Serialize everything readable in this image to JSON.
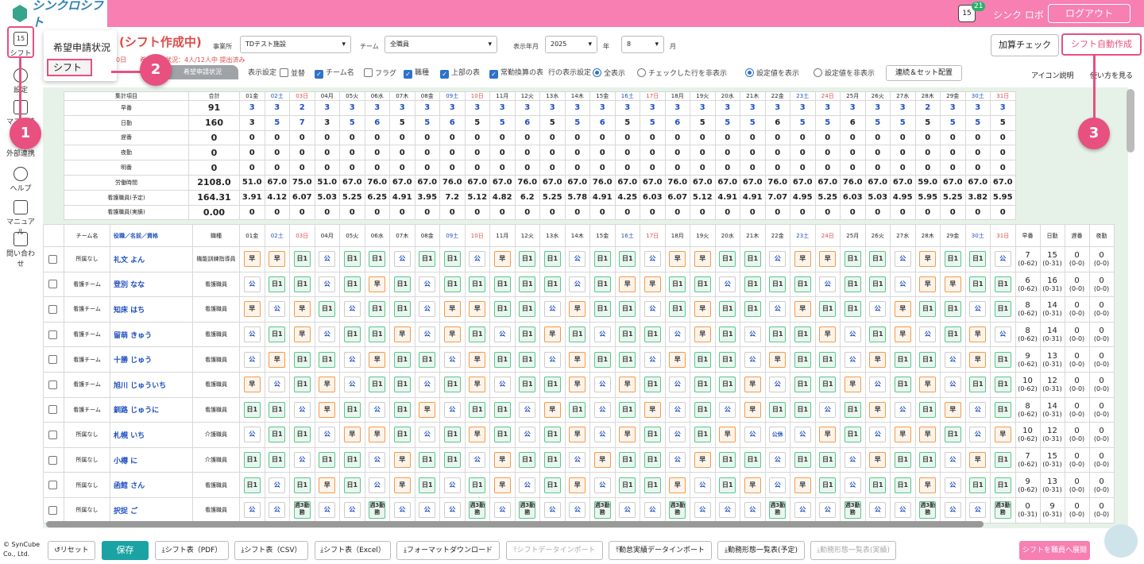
{
  "app": {
    "name": "シンクロシフト",
    "notifications": "21",
    "user": "シンク ロボ",
    "logout": "ログアウト",
    "cal_day": "15"
  },
  "sidebar": [
    {
      "label": "シフト",
      "icon": "calendar-icon"
    },
    {
      "label": "設定",
      "icon": "gear-icon"
    },
    {
      "label": "マスタ管理",
      "icon": "database-icon"
    },
    {
      "label": "外部連携",
      "icon": "link-icon"
    },
    {
      "label": "ヘルプ",
      "icon": "help-icon"
    },
    {
      "label": "マニュアル",
      "icon": "edit-icon"
    },
    {
      "label": "問い合わせ",
      "icon": "mail-icon"
    }
  ],
  "menu": {
    "item1": "希望申請状況",
    "item2": "シフト"
  },
  "annotations": {
    "a1": "1",
    "a2": "2",
    "a3": "3"
  },
  "header": {
    "title": "(シフト作成中)",
    "note1": "0日",
    "note2": "希望申請状況：4人/12人中 提出済み",
    "sub_tab": "希望申請状況",
    "office_label": "事業所",
    "office": "TDテスト施設",
    "team_label": "チーム",
    "team": "全職員",
    "ym_label": "表示年月",
    "year": "2025",
    "year_unit": "年",
    "month": "8",
    "month_unit": "月",
    "calc_check": "加算チェック",
    "auto_create": "シフト自動作成"
  },
  "options": {
    "display_label": "表示設定",
    "sort": "並替",
    "team_name": "チーム名",
    "flag": "フラグ",
    "job": "職種",
    "top_table": "上部の表",
    "fulltime": "常勤換算の表",
    "row_label": "行の表示設定",
    "show_all": "全表示",
    "hide_checked": "チェックした行を非表示",
    "show_settings": "設定値を表示",
    "hide_settings": "設定値を非表示",
    "link_btn": "連続＆セット配置",
    "icon_help": "アイコン説明",
    "howto": "使い方を見る"
  },
  "summary": {
    "header_item": "集計項目",
    "header_total": "合計",
    "days": [
      "01金",
      "02土",
      "03日",
      "04月",
      "05火",
      "06水",
      "07木",
      "08金",
      "09土",
      "10日",
      "11月",
      "12火",
      "13水",
      "14木",
      "15金",
      "16土",
      "17日",
      "18月",
      "19火",
      "20水",
      "21木",
      "22金",
      "23土",
      "24日",
      "25月",
      "26火",
      "27水",
      "28木",
      "29金",
      "30土",
      "31日"
    ],
    "rows": [
      {
        "label": "早番",
        "total": "91",
        "vals": [
          "3",
          "3",
          "2",
          "3",
          "3",
          "3",
          "3",
          "3",
          "3",
          "3",
          "3",
          "3",
          "3",
          "3",
          "3",
          "3",
          "3",
          "3",
          "3",
          "3",
          "3",
          "3",
          "3",
          "3",
          "3",
          "3",
          "3",
          "2",
          "3",
          "3",
          "3"
        ]
      },
      {
        "label": "日勤",
        "total": "160",
        "vals": [
          "3",
          "5",
          "7",
          "3",
          "5",
          "6",
          "5",
          "5",
          "6",
          "5",
          "5",
          "6",
          "5",
          "5",
          "6",
          "5",
          "5",
          "6",
          "5",
          "5",
          "5",
          "6",
          "5",
          "5",
          "6",
          "5",
          "5",
          "5",
          "5",
          "5",
          "5"
        ]
      },
      {
        "label": "遅番",
        "total": "0",
        "vals": [
          "0",
          "0",
          "0",
          "0",
          "0",
          "0",
          "0",
          "0",
          "0",
          "0",
          "0",
          "0",
          "0",
          "0",
          "0",
          "0",
          "0",
          "0",
          "0",
          "0",
          "0",
          "0",
          "0",
          "0",
          "0",
          "0",
          "0",
          "0",
          "0",
          "0",
          "0"
        ]
      },
      {
        "label": "夜勤",
        "total": "0",
        "vals": [
          "0",
          "0",
          "0",
          "0",
          "0",
          "0",
          "0",
          "0",
          "0",
          "0",
          "0",
          "0",
          "0",
          "0",
          "0",
          "0",
          "0",
          "0",
          "0",
          "0",
          "0",
          "0",
          "0",
          "0",
          "0",
          "0",
          "0",
          "0",
          "0",
          "0",
          "0"
        ]
      },
      {
        "label": "明番",
        "total": "0",
        "vals": [
          "0",
          "0",
          "0",
          "0",
          "0",
          "0",
          "0",
          "0",
          "0",
          "0",
          "0",
          "0",
          "0",
          "0",
          "0",
          "0",
          "0",
          "0",
          "0",
          "0",
          "0",
          "0",
          "0",
          "0",
          "0",
          "0",
          "0",
          "0",
          "0",
          "0",
          "0"
        ]
      },
      {
        "label": "労働時間",
        "total": "2108.0",
        "vals": [
          "51.0",
          "67.0",
          "75.0",
          "51.0",
          "67.0",
          "76.0",
          "67.0",
          "67.0",
          "76.0",
          "67.0",
          "67.0",
          "76.0",
          "67.0",
          "67.0",
          "76.0",
          "67.0",
          "67.0",
          "76.0",
          "67.0",
          "67.0",
          "67.0",
          "76.0",
          "67.0",
          "67.0",
          "76.0",
          "67.0",
          "67.0",
          "59.0",
          "67.0",
          "67.0",
          "67.0"
        ]
      },
      {
        "label": "看護職員(予定)",
        "total": "164.31",
        "vals": [
          "3.91",
          "4.12",
          "6.07",
          "5.03",
          "5.25",
          "6.25",
          "4.91",
          "3.95",
          "7.2",
          "5.12",
          "4.82",
          "6.2",
          "5.25",
          "5.78",
          "4.91",
          "4.25",
          "6.03",
          "6.07",
          "5.12",
          "4.91",
          "4.91",
          "7.07",
          "4.95",
          "5.25",
          "6.03",
          "5.03",
          "4.95",
          "5.95",
          "5.25",
          "3.82",
          "5.95"
        ]
      },
      {
        "label": "看護職員(実績)",
        "total": "0.00",
        "vals": [
          "0",
          "0",
          "0",
          "0",
          "0",
          "0",
          "0",
          "0",
          "0",
          "0",
          "0",
          "0",
          "0",
          "0",
          "0",
          "0",
          "0",
          "0",
          "0",
          "0",
          "0",
          "0",
          "0",
          "0",
          "0",
          "0",
          "0",
          "0",
          "0",
          "0",
          "0"
        ]
      }
    ]
  },
  "staff_table": {
    "col_team": "チーム名",
    "col_name": "役職／名前／資格",
    "col_job": "職種",
    "col_haya": "早番",
    "col_nichi": "日勤",
    "col_oso": "遅番",
    "col_yakin": "夜勤",
    "rows": [
      {
        "team": "所属なし",
        "name": "礼文 よん",
        "job": "機能訓練指導員",
        "shifts": [
          "早",
          "早",
          "日1",
          "公",
          "日1",
          "日1",
          "公",
          "日1",
          "日1",
          "公",
          "早",
          "日1",
          "日1",
          "公",
          "日1",
          "日1",
          "公",
          "早",
          "早",
          "日1",
          "日1",
          "公",
          "早",
          "早",
          "日1",
          "日1",
          "公",
          "早",
          "日1",
          "日1",
          "公"
        ],
        "st": [
          "7",
          "15",
          "0",
          "0"
        ],
        "rng": [
          "(0-62)",
          "(0-31)",
          "(0-0)",
          "(0-0)"
        ]
      },
      {
        "team": "看護チーム",
        "name": "登別 なな",
        "job": "看護職員",
        "shifts": [
          "公",
          "日1",
          "日1",
          "公",
          "日1",
          "早",
          "日1",
          "公",
          "日1",
          "日1",
          "日1",
          "日1",
          "日1",
          "公",
          "日1",
          "早",
          "早",
          "日1",
          "日1",
          "公",
          "日1",
          "日1",
          "日1",
          "公",
          "日1",
          "日1",
          "公",
          "早",
          "早",
          "日1",
          "日1"
        ],
        "st": [
          "6",
          "16",
          "0",
          "0"
        ],
        "rng": [
          "(0-62)",
          "(0-31)",
          "(0-0)",
          "(0-0)"
        ]
      },
      {
        "team": "看護チーム",
        "name": "知床 はち",
        "job": "看護職員",
        "shifts": [
          "早",
          "公",
          "早",
          "日1",
          "公",
          "日1",
          "日1",
          "公",
          "早",
          "早",
          "日1",
          "日1",
          "公",
          "早",
          "日1",
          "日1",
          "公",
          "日1",
          "早",
          "日1",
          "日1",
          "公",
          "早",
          "日1",
          "日1",
          "公",
          "早",
          "日1",
          "日1",
          "公",
          "日1"
        ],
        "st": [
          "8",
          "14",
          "0",
          "0"
        ],
        "rng": [
          "(0-62)",
          "(0-31)",
          "(0-0)",
          "(0-0)"
        ]
      },
      {
        "team": "看護チーム",
        "name": "留萌 きゅう",
        "job": "看護職員",
        "shifts": [
          "公",
          "日1",
          "早",
          "公",
          "日1",
          "日1",
          "早",
          "公",
          "早",
          "日1",
          "公",
          "日1",
          "早",
          "日1",
          "公",
          "日1",
          "日1",
          "公",
          "早",
          "日1",
          "公",
          "日1",
          "日1",
          "早",
          "公",
          "日1",
          "早",
          "公",
          "日1",
          "早",
          "公"
        ],
        "st": [
          "8",
          "14",
          "0",
          "0"
        ],
        "rng": [
          "(0-62)",
          "(0-31)",
          "(0-0)",
          "(0-0)"
        ]
      },
      {
        "team": "看護チーム",
        "name": "十勝 じゅう",
        "job": "看護職員",
        "shifts": [
          "公",
          "早",
          "日1",
          "日1",
          "公",
          "早",
          "日1",
          "日1",
          "公",
          "早",
          "日1",
          "日1",
          "公",
          "早",
          "日1",
          "日1",
          "公",
          "早",
          "日1",
          "日1",
          "公",
          "早",
          "日1",
          "日1",
          "公",
          "早",
          "日1",
          "日1",
          "公",
          "早",
          "日1"
        ],
        "st": [
          "9",
          "13",
          "0",
          "0"
        ],
        "rng": [
          "(0-62)",
          "(0-31)",
          "(0-0)",
          "(0-0)"
        ]
      },
      {
        "team": "看護チーム",
        "name": "旭川 じゅういち",
        "job": "看護職員",
        "shifts": [
          "早",
          "公",
          "日1",
          "早",
          "公",
          "日1",
          "日1",
          "公",
          "日1",
          "早",
          "公",
          "日1",
          "日1",
          "早",
          "公",
          "早",
          "日1",
          "公",
          "日1",
          "日1",
          "早",
          "公",
          "日1",
          "日1",
          "早",
          "公",
          "日1",
          "早",
          "公",
          "日1",
          "日1"
        ],
        "st": [
          "10",
          "12",
          "0",
          "0"
        ],
        "rng": [
          "(0-62)",
          "(0-31)",
          "(0-0)",
          "(0-0)"
        ]
      },
      {
        "team": "看護チーム",
        "name": "釧路 じゅうに",
        "job": "看護職員",
        "shifts": [
          "日1",
          "日1",
          "公",
          "早",
          "日1",
          "公",
          "日1",
          "早",
          "公",
          "日1",
          "日1",
          "公",
          "早",
          "日1",
          "公",
          "日1",
          "早",
          "公",
          "日1",
          "公",
          "早",
          "日1",
          "日1",
          "公",
          "日1",
          "早",
          "公",
          "日1",
          "早",
          "公",
          "日1"
        ],
        "st": [
          "8",
          "14",
          "0",
          "0"
        ],
        "rng": [
          "(0-62)",
          "(0-31)",
          "(0-0)",
          "(0-0)"
        ]
      },
      {
        "team": "所属なし",
        "name": "札幌 いち",
        "job": "介護職員",
        "shifts": [
          "公",
          "日1",
          "日1",
          "公",
          "早",
          "早",
          "日1",
          "公",
          "日1",
          "早",
          "日1",
          "公",
          "日1",
          "早",
          "公",
          "早",
          "日1",
          "公",
          "日1",
          "早",
          "公",
          "公休",
          "公",
          "早",
          "日1",
          "公",
          "早",
          "早",
          "日1",
          "公",
          "早"
        ],
        "st": [
          "10",
          "12",
          "0",
          "0"
        ],
        "rng": [
          "(0-62)",
          "(0-31)",
          "(0-0)",
          "(0-0)"
        ]
      },
      {
        "team": "所属なし",
        "name": "小樽 に",
        "job": "介護職員",
        "shifts": [
          "日1",
          "日1",
          "公",
          "日1",
          "日1",
          "公",
          "早",
          "日1",
          "日1",
          "公",
          "早",
          "日1",
          "日1",
          "公",
          "早",
          "日1",
          "日1",
          "公",
          "早",
          "日1",
          "日1",
          "公",
          "日1",
          "日1",
          "公",
          "早",
          "日1",
          "日1",
          "公",
          "早",
          "日1"
        ],
        "st": [
          "7",
          "15",
          "0",
          "0"
        ],
        "rng": [
          "(0-62)",
          "(0-31)",
          "(0-0)",
          "(0-0)"
        ]
      },
      {
        "team": "所属なし",
        "name": "函館 さん",
        "job": "看護職員",
        "shifts": [
          "日1",
          "公",
          "日1",
          "早",
          "日1",
          "公",
          "早",
          "日1",
          "公",
          "日1",
          "早",
          "公",
          "日1",
          "早",
          "公",
          "日1",
          "日1",
          "早",
          "公",
          "日1",
          "早",
          "公",
          "早",
          "日1",
          "公",
          "日1",
          "日1",
          "早",
          "公",
          "日1",
          "日1"
        ],
        "st": [
          "9",
          "13",
          "0",
          "0"
        ],
        "rng": [
          "(0-62)",
          "(0-31)",
          "(0-0)",
          "(0-0)"
        ]
      },
      {
        "team": "所属なし",
        "name": "択捉 ご",
        "job": "看護職員",
        "shifts": [
          "公",
          "公",
          "週3勤務",
          "公",
          "公",
          "週3勤務",
          "公",
          "公",
          "公",
          "週3勤務",
          "公",
          "週3勤務",
          "公",
          "公",
          "週3勤務",
          "公",
          "公",
          "週3勤務",
          "公",
          "公",
          "公",
          "週3勤務",
          "公",
          "公",
          "週3勤務",
          "公",
          "公",
          "週3勤務",
          "公",
          "公",
          "週3勤務"
        ],
        "st": [
          "0",
          "9",
          "0",
          "0"
        ],
        "rng": [
          "(0-31)",
          "(0-31)",
          "(0-0)",
          "(0-0)"
        ]
      }
    ]
  },
  "footer": {
    "copyright1": "© SynCube",
    "copyright2": "Co., Ltd.",
    "reset": "リセット",
    "save": "保存",
    "pdf": "シフト表（PDF）",
    "csv": "シフト表（CSV）",
    "excel": "シフト表（Excel）",
    "format_dl": "フォーマットダウンロード",
    "import": "シフトデータインポート",
    "attend_import": "勤怠実績データインポート",
    "plan_list": "勤務形態一覧表(予定)",
    "actual_list": "勤務形態一覧表(実績)",
    "deploy": "シフトを職員へ展開"
  }
}
